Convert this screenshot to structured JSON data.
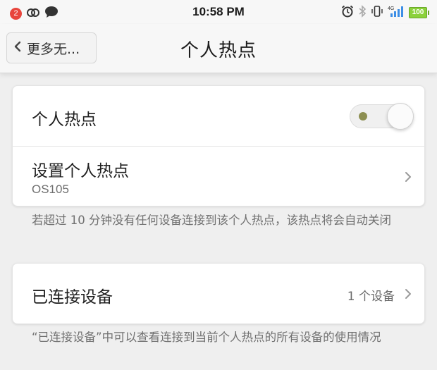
{
  "status_bar": {
    "notification_count": "2",
    "time": "10:58 PM",
    "network": "4G",
    "battery": "100",
    "left_icons": [
      "notification-badge",
      "chain-link-icon",
      "chat-bubble-icon"
    ],
    "right_icons": [
      "alarm-clock-icon",
      "bluetooth-icon",
      "vibrate-icon",
      "signal-icon",
      "battery-icon"
    ]
  },
  "header": {
    "back_label": "更多无...",
    "title": "个人热点"
  },
  "hotspot_card": {
    "toggle_label": "个人热点",
    "toggle_on": true,
    "setup_label": "设置个人热点",
    "setup_sub": "OS105"
  },
  "note_1": "若超过 10 分钟没有任何设备连接到该个人热点，该热点将会自动关闭",
  "devices_card": {
    "label": "已连接设备",
    "value": "1 个设备"
  },
  "note_2": "“已连接设备”中可以查看连接到当前个人热点的所有设备的使用情况",
  "colors": {
    "background": "#efefef",
    "card": "#ffffff",
    "notification_badge": "#e8453c",
    "battery": "#8bd13b",
    "signal": "#3c8ee6",
    "toggle_dot": "#8d8f52"
  }
}
